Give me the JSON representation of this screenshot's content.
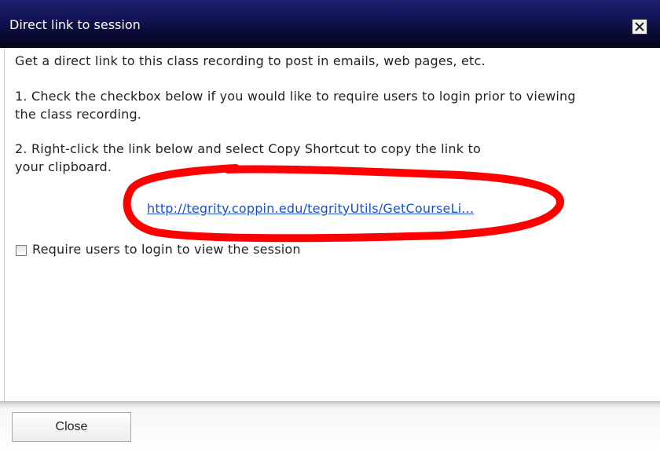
{
  "dialog": {
    "title": "Direct link to session",
    "close_icon": "close-x-icon",
    "intro": "Get a direct link to this class recording to post in emails, web pages, etc.",
    "step1_line1": "1. Check the checkbox below if you would like to require users to login prior to viewing",
    "step1_line2": "the class recording.",
    "step2_line1": "2. Right-click the link below and select Copy Shortcut to copy the link to",
    "step2_line2": "your clipboard.",
    "link_text": "http://tegrity.coppin.edu/tegrityUtils/GetCourseLi...",
    "checkbox_label": "Require users to login to view the session",
    "checkbox_checked": false,
    "close_button_label": "Close"
  },
  "colors": {
    "titlebar_top": "#1d1f6e",
    "titlebar_bottom": "#050518",
    "link": "#1a4fd0",
    "annotation": "#ff0000"
  }
}
